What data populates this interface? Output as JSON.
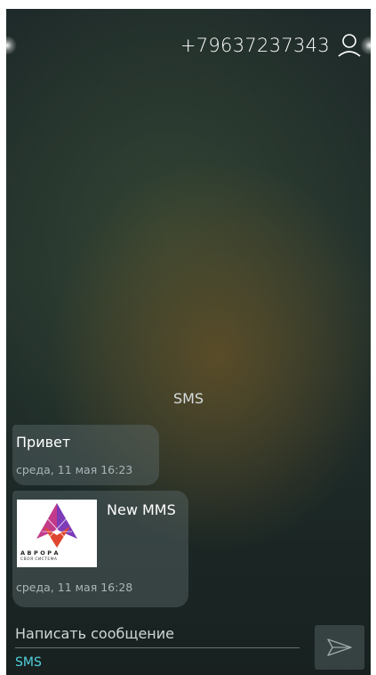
{
  "header": {
    "phone_number": "+79637237343",
    "contact_icon": "person-icon"
  },
  "thread": {
    "type_label": "SMS",
    "messages": [
      {
        "text": "Привет",
        "time": "среда, 11 мая 16:23"
      },
      {
        "text": "New MMS",
        "time": "среда, 11 мая 16:28",
        "thumbnail": {
          "brand": "АВРОРА",
          "tagline": "СВОЯ СИСТЕМА"
        }
      }
    ]
  },
  "composer": {
    "placeholder": "Написать сообщение",
    "mode": "SMS",
    "send_icon": "send-icon"
  },
  "colors": {
    "accent": "#4fd2e0",
    "bubble": "#5f6e70",
    "background": "#1f2b2a"
  }
}
